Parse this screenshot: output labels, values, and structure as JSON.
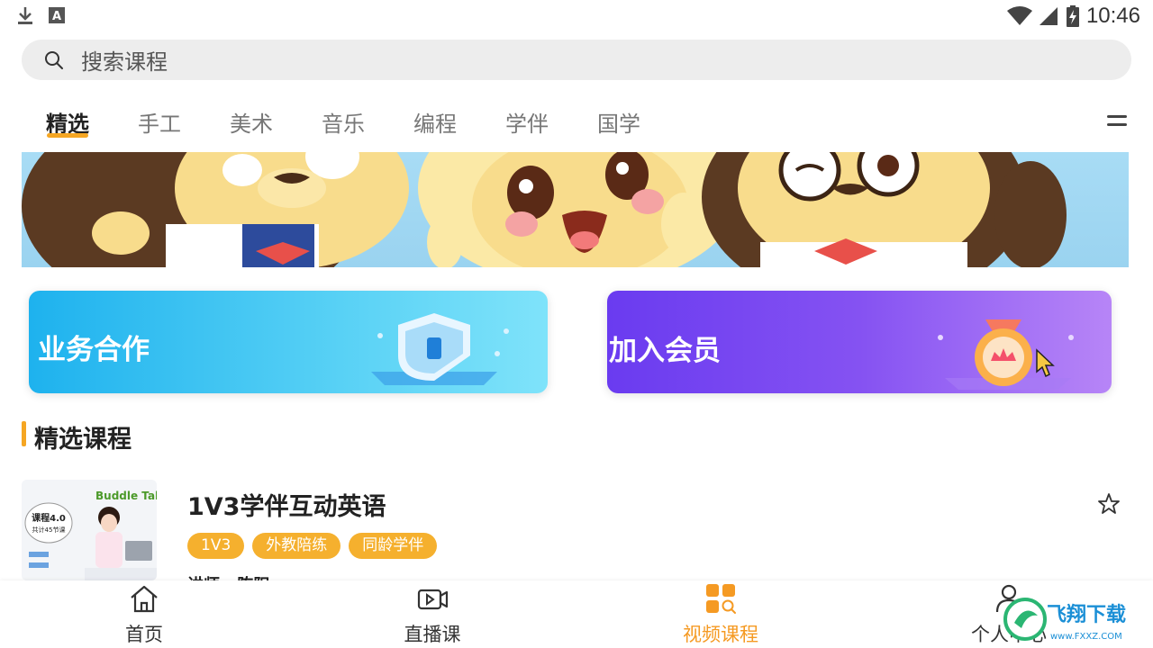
{
  "status_bar": {
    "time": "10:46",
    "left_icons": [
      "download-icon",
      "a-box-icon"
    ],
    "right_icons": [
      "wifi-icon",
      "cell-signal-icon",
      "battery-charging-icon"
    ]
  },
  "search": {
    "placeholder": "搜索课程",
    "icon": "search-icon"
  },
  "tabs": [
    {
      "label": "精选",
      "active": true
    },
    {
      "label": "手工",
      "active": false
    },
    {
      "label": "美术",
      "active": false
    },
    {
      "label": "音乐",
      "active": false
    },
    {
      "label": "编程",
      "active": false
    },
    {
      "label": "学伴",
      "active": false
    },
    {
      "label": "国学",
      "active": false
    }
  ],
  "promos": {
    "cooperation": {
      "label": "业务合作",
      "icon": "shield-icon"
    },
    "membership": {
      "label": "加入会员",
      "icon": "crown-medal-icon"
    }
  },
  "section": {
    "title": "精选课程"
  },
  "course": {
    "title": "1V3学伴互动英语",
    "tags": [
      "1V3",
      "外教陪练",
      "同龄学伴"
    ],
    "teacher_partial": "讲师 · 陈阳",
    "thumbnail_text": {
      "brand": "Buddle Talk",
      "badge_line1": "课程4.0",
      "badge_line2": "共计45节课"
    }
  },
  "bottom_nav": [
    {
      "label": "首页",
      "icon": "home-icon",
      "active": false
    },
    {
      "label": "直播课",
      "icon": "video-camera-icon",
      "active": false
    },
    {
      "label": "视频课程",
      "icon": "grid-search-icon",
      "active": true
    },
    {
      "label": "个人中心",
      "icon": "user-icon",
      "active": false
    }
  ],
  "watermark": {
    "text": "飞翔下载",
    "subtext": "www.FXXZ.COM"
  },
  "colors": {
    "accent": "#f5a623",
    "active_nav": "#f59a23",
    "coop_gradient_start": "#1eb2ee",
    "vip_gradient_start": "#6a3bf0"
  }
}
